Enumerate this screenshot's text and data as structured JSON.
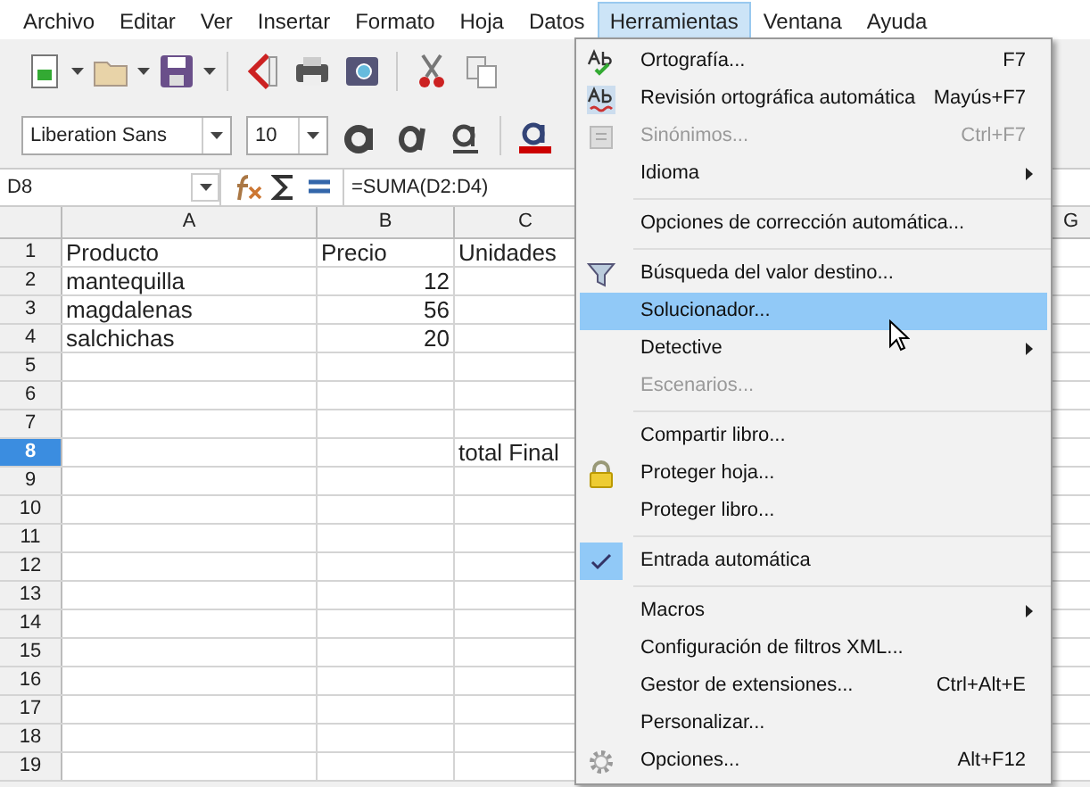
{
  "menubar": [
    {
      "label": "Archivo",
      "selected": false
    },
    {
      "label": "Editar",
      "selected": false
    },
    {
      "label": "Ver",
      "selected": false
    },
    {
      "label": "Insertar",
      "selected": false
    },
    {
      "label": "Formato",
      "selected": false
    },
    {
      "label": "Hoja",
      "selected": false
    },
    {
      "label": "Datos",
      "selected": false
    },
    {
      "label": "Herramientas",
      "selected": true
    },
    {
      "label": "Ventana",
      "selected": false
    },
    {
      "label": "Ayuda",
      "selected": false
    }
  ],
  "format_bar": {
    "font_name": "Liberation Sans",
    "font_size": "10"
  },
  "formula_bar": {
    "cell_reference": "D8",
    "formula": "=SUMA(D2:D4)"
  },
  "sheet": {
    "columns": [
      "A",
      "B",
      "C",
      "G"
    ],
    "rows": [
      {
        "header": "1",
        "selected": false,
        "cells": [
          "Producto",
          "Precio",
          "Unidades"
        ]
      },
      {
        "header": "2",
        "selected": false,
        "cells": [
          "mantequilla",
          "12",
          null
        ]
      },
      {
        "header": "3",
        "selected": false,
        "cells": [
          "magdalenas",
          "56",
          null
        ]
      },
      {
        "header": "4",
        "selected": false,
        "cells": [
          "salchichas",
          "20",
          null
        ]
      },
      {
        "header": "5",
        "selected": false,
        "cells": [
          null,
          null,
          null
        ]
      },
      {
        "header": "6",
        "selected": false,
        "cells": [
          null,
          null,
          null
        ]
      },
      {
        "header": "7",
        "selected": false,
        "cells": [
          null,
          null,
          null
        ]
      },
      {
        "header": "8",
        "selected": true,
        "cells": [
          null,
          null,
          "total Final"
        ]
      },
      {
        "header": "9",
        "selected": false,
        "cells": [
          null,
          null,
          null
        ]
      },
      {
        "header": "10",
        "selected": false,
        "cells": [
          null,
          null,
          null
        ]
      },
      {
        "header": "11",
        "selected": false,
        "cells": [
          null,
          null,
          null
        ]
      },
      {
        "header": "12",
        "selected": false,
        "cells": [
          null,
          null,
          null
        ]
      },
      {
        "header": "13",
        "selected": false,
        "cells": [
          null,
          null,
          null
        ]
      },
      {
        "header": "14",
        "selected": false,
        "cells": [
          null,
          null,
          null
        ]
      },
      {
        "header": "15",
        "selected": false,
        "cells": [
          null,
          null,
          null
        ]
      },
      {
        "header": "16",
        "selected": false,
        "cells": [
          null,
          null,
          null
        ]
      },
      {
        "header": "17",
        "selected": false,
        "cells": [
          null,
          null,
          null
        ]
      },
      {
        "header": "18",
        "selected": false,
        "cells": [
          null,
          null,
          null
        ]
      },
      {
        "header": "19",
        "selected": false,
        "cells": [
          null,
          null,
          null
        ]
      }
    ]
  },
  "tools_menu": [
    {
      "kind": "spelling",
      "label": "Ortografía...",
      "shortcut": "F7",
      "disabled": false,
      "submenu": false,
      "selected": false,
      "checked": false
    },
    {
      "kind": "autospell",
      "label": "Revisión ortográfica automática",
      "shortcut": "Mayús+F7",
      "disabled": false,
      "submenu": false,
      "selected": false,
      "checked": false
    },
    {
      "kind": "thesaurus",
      "label": "Sinónimos...",
      "shortcut": "Ctrl+F7",
      "disabled": true,
      "submenu": false,
      "selected": false,
      "checked": false
    },
    {
      "kind": "plain",
      "label": "Idioma",
      "disabled": false,
      "submenu": true,
      "selected": false,
      "checked": false
    },
    {
      "kind": "separator"
    },
    {
      "kind": "plain",
      "label": "Opciones de corrección automática...",
      "disabled": false,
      "submenu": false,
      "selected": false,
      "checked": false
    },
    {
      "kind": "separator"
    },
    {
      "kind": "goal-seek",
      "label": "Búsqueda del valor destino...",
      "disabled": false,
      "submenu": false,
      "selected": false,
      "checked": false
    },
    {
      "kind": "plain",
      "label": "Solucionador...",
      "disabled": false,
      "submenu": false,
      "selected": true,
      "checked": false
    },
    {
      "kind": "plain",
      "label": "Detective",
      "disabled": false,
      "submenu": true,
      "selected": false,
      "checked": false
    },
    {
      "kind": "plain",
      "label": "Escenarios...",
      "disabled": true,
      "submenu": false,
      "selected": false,
      "checked": false
    },
    {
      "kind": "separator"
    },
    {
      "kind": "plain",
      "label": "Compartir libro...",
      "disabled": false,
      "submenu": false,
      "selected": false,
      "checked": false
    },
    {
      "kind": "protect",
      "label": "Proteger hoja...",
      "disabled": false,
      "submenu": false,
      "selected": false,
      "checked": false
    },
    {
      "kind": "plain",
      "label": "Proteger libro...",
      "disabled": false,
      "submenu": false,
      "selected": false,
      "checked": false
    },
    {
      "kind": "separator"
    },
    {
      "kind": "plain",
      "label": "Entrada automática",
      "disabled": false,
      "submenu": false,
      "selected": false,
      "checked": true
    },
    {
      "kind": "separator"
    },
    {
      "kind": "plain",
      "label": "Macros",
      "disabled": false,
      "submenu": true,
      "selected": false,
      "checked": false
    },
    {
      "kind": "plain",
      "label": "Configuración de filtros XML...",
      "disabled": false,
      "submenu": false,
      "selected": false,
      "checked": false
    },
    {
      "kind": "plain",
      "label": "Gestor de extensiones...",
      "shortcut": "Ctrl+Alt+E",
      "disabled": false,
      "submenu": false,
      "selected": false,
      "checked": false
    },
    {
      "kind": "plain",
      "label": "Personalizar...",
      "disabled": false,
      "submenu": false,
      "selected": false,
      "checked": false
    },
    {
      "kind": "options",
      "label": "Opciones...",
      "shortcut": "Alt+F12",
      "disabled": false,
      "submenu": false,
      "selected": false,
      "checked": false
    }
  ]
}
